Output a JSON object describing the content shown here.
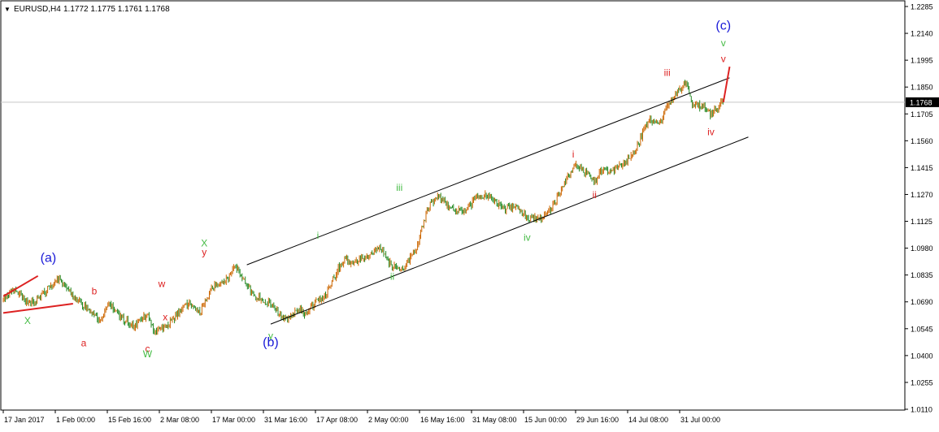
{
  "header": {
    "symbol": "EURUSD,H4",
    "ohlc": "1.1772 1.1775 1.1761 1.1768",
    "menu_glyph": "▼"
  },
  "chart_data": {
    "type": "candlestick",
    "symbol": "EURUSD",
    "timeframe": "H4",
    "ylim": [
      1.011,
      1.2285
    ],
    "current_price": 1.1768,
    "current_price_label": "1.1768",
    "colors": {
      "candle": "#cc6600",
      "candle_dark": "#228822",
      "channel": "#000000",
      "wave_red": "#dd2222",
      "wave_green": "#44bb44",
      "wave_blue": "#1a1ad8",
      "grid_hline": "#c8c8c8"
    },
    "y_ticks": [
      "1.2285",
      "1.2140",
      "1.1995",
      "1.1850",
      "1.1705",
      "1.1560",
      "1.1415",
      "1.1270",
      "1.1125",
      "1.0980",
      "1.0835",
      "1.0690",
      "1.0545",
      "1.0400",
      "1.0255",
      "1.0110"
    ],
    "x_ticks": [
      "17 Jan 2017",
      "1 Feb 00:00",
      "15 Feb 16:00",
      "2 Mar 08:00",
      "17 Mar 00:00",
      "31 Mar 16:00",
      "17 Apr 08:00",
      "2 May 00:00",
      "16 May 16:00",
      "31 May 08:00",
      "15 Jun 00:00",
      "29 Jun 16:00",
      "14 Jul 08:00",
      "31 Jul 00:00"
    ],
    "price_path": [
      [
        "17 Jan 2017",
        1.07
      ],
      [
        "20 Jan 2017",
        1.076
      ],
      [
        "24 Jan 2017",
        1.068
      ],
      [
        "27 Jan 2017",
        1.07
      ],
      [
        "30 Jan 2017",
        1.076
      ],
      [
        "2 Feb 2017",
        1.082
      ],
      [
        "6 Feb 2017",
        1.072
      ],
      [
        "10 Feb 2017",
        1.065
      ],
      [
        "14 Feb 2017",
        1.059
      ],
      [
        "16 Feb 2017",
        1.068
      ],
      [
        "20 Feb 2017",
        1.06
      ],
      [
        "23 Feb 2017",
        1.056
      ],
      [
        "27 Feb 2017",
        1.062
      ],
      [
        "1 Mar 2017",
        1.052
      ],
      [
        "6 Mar 2017",
        1.059
      ],
      [
        "10 Mar 2017",
        1.068
      ],
      [
        "14 Mar 2017",
        1.064
      ],
      [
        "17 Mar 2017",
        1.076
      ],
      [
        "21 Mar 2017",
        1.08
      ],
      [
        "24 Mar 2017",
        1.088
      ],
      [
        "29 Mar 2017",
        1.072
      ],
      [
        "3 Apr 2017",
        1.068
      ],
      [
        "7 Apr 2017",
        1.06
      ],
      [
        "10 Apr 2017",
        1.062
      ],
      [
        "12 Apr 2017",
        1.066
      ],
      [
        "14 Apr 2017",
        1.062
      ],
      [
        "18 Apr 2017",
        1.07
      ],
      [
        "20 Apr 2017",
        1.072
      ],
      [
        "24 Apr 2017",
        1.088
      ],
      [
        "26 Apr 2017",
        1.092
      ],
      [
        "28 Apr 2017",
        1.09
      ],
      [
        "2 May 2017",
        1.093
      ],
      [
        "5 May 2017",
        1.099
      ],
      [
        "9 May 2017",
        1.088
      ],
      [
        "12 May 2017",
        1.087
      ],
      [
        "16 May 2017",
        1.099
      ],
      [
        "19 May 2017",
        1.12
      ],
      [
        "22 May 2017",
        1.126
      ],
      [
        "25 May 2017",
        1.12
      ],
      [
        "29 May 2017",
        1.117
      ],
      [
        "2 Jun 2017",
        1.126
      ],
      [
        "6 Jun 2017",
        1.126
      ],
      [
        "9 Jun 2017",
        1.119
      ],
      [
        "13 Jun 2017",
        1.121
      ],
      [
        "16 Jun 2017",
        1.114
      ],
      [
        "20 Jun 2017",
        1.114
      ],
      [
        "23 Jun 2017",
        1.12
      ],
      [
        "28 Jun 2017",
        1.138
      ],
      [
        "30 Jun 2017",
        1.143
      ],
      [
        "5 Jul 2017",
        1.134
      ],
      [
        "7 Jul 2017",
        1.14
      ],
      [
        "11 Jul 2017",
        1.141
      ],
      [
        "14 Jul 2017",
        1.145
      ],
      [
        "18 Jul 2017",
        1.155
      ],
      [
        "21 Jul 2017",
        1.168
      ],
      [
        "25 Jul 2017",
        1.166
      ],
      [
        "27 Jul 2017",
        1.175
      ],
      [
        "31 Jul 2017",
        1.184
      ],
      [
        "2 Aug 2017",
        1.188
      ],
      [
        "4 Aug 2017",
        1.176
      ],
      [
        "8 Aug 2017",
        1.174
      ],
      [
        "10 Aug 2017",
        1.17
      ],
      [
        "14 Aug 2017",
        1.1768
      ]
    ],
    "projection": [
      [
        "14 Aug 2017",
        1.1768
      ],
      [
        "16 Aug 2017",
        1.196
      ]
    ],
    "wedge_lines": [
      [
        [
          "17 Jan 2017",
          1.072
        ],
        [
          "27 Jan 2017",
          1.083
        ]
      ],
      [
        [
          "17 Jan 2017",
          1.063
        ],
        [
          "6 Feb 2017",
          1.068
        ]
      ]
    ],
    "channel_lines": [
      [
        [
          "27 Mar 2017",
          1.089
        ],
        [
          "16 Aug 2017",
          1.19
        ]
      ],
      [
        [
          "3 Apr 2017",
          1.057
        ],
        [
          "22 Aug 2017",
          1.158
        ]
      ]
    ],
    "wave_labels": [
      {
        "text": "(a)",
        "date": "30 Jan 2017",
        "price": 1.0905,
        "color": "blue"
      },
      {
        "text": "X",
        "date": "24 Jan 2017",
        "price": 1.057,
        "color": "green"
      },
      {
        "text": "b",
        "date": "12 Feb 2017",
        "price": 1.073,
        "color": "red"
      },
      {
        "text": "a",
        "date": "9 Feb 2017",
        "price": 1.045,
        "color": "red"
      },
      {
        "text": "c",
        "date": "27 Feb 2017",
        "price": 1.042,
        "color": "red"
      },
      {
        "text": "W",
        "date": "27 Feb 2017",
        "price": 1.039,
        "color": "green"
      },
      {
        "text": "w",
        "date": "3 Mar 2017",
        "price": 1.077,
        "color": "red"
      },
      {
        "text": "x",
        "date": "4 Mar 2017",
        "price": 1.059,
        "color": "red"
      },
      {
        "text": "X",
        "date": "15 Mar 2017",
        "price": 1.099,
        "color": "green"
      },
      {
        "text": "y",
        "date": "15 Mar 2017",
        "price": 1.094,
        "color": "red"
      },
      {
        "text": "y",
        "date": "3 Apr 2017",
        "price": 1.049,
        "color": "green"
      },
      {
        "text": "(b)",
        "date": "3 Apr 2017",
        "price": 1.045,
        "color": "blue"
      },
      {
        "text": "i",
        "date": "18 Apr 2017",
        "price": 1.103,
        "color": "green"
      },
      {
        "text": "ii",
        "date": "9 May 2017",
        "price": 1.081,
        "color": "green"
      },
      {
        "text": "iii",
        "date": "11 May 2017",
        "price": 1.129,
        "color": "green"
      },
      {
        "text": "iv",
        "date": "16 Jun 2017",
        "price": 1.102,
        "color": "green"
      },
      {
        "text": "i",
        "date": "29 Jun 2017",
        "price": 1.147,
        "color": "red"
      },
      {
        "text": "ii",
        "date": "5 Jul 2017",
        "price": 1.125,
        "color": "red"
      },
      {
        "text": "iii",
        "date": "27 Jul 2017",
        "price": 1.191,
        "color": "red"
      },
      {
        "text": "iv",
        "date": "10 Aug 2017",
        "price": 1.159,
        "color": "red"
      },
      {
        "text": "(c)",
        "date": "14 Aug 2017",
        "price": 1.216,
        "color": "blue"
      },
      {
        "text": "v",
        "date": "14 Aug 2017",
        "price": 1.207,
        "color": "green"
      },
      {
        "text": "v",
        "date": "14 Aug 2017",
        "price": 1.1985,
        "color": "red"
      }
    ]
  }
}
